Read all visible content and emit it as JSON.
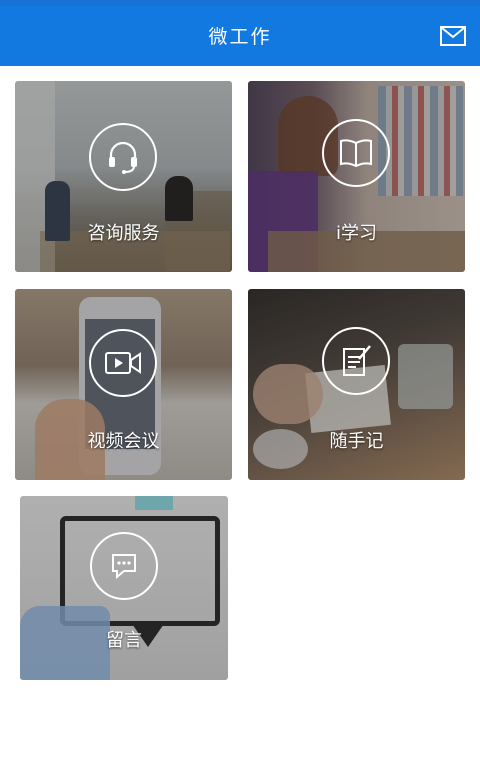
{
  "header": {
    "title": "微工作",
    "mail_icon": "mail-icon",
    "bg_color": "#1279e0"
  },
  "tiles": [
    {
      "label": "咨询服务",
      "icon": "headset-icon"
    },
    {
      "label": "i学习",
      "icon": "book-icon"
    },
    {
      "label": "视频会议",
      "icon": "video-camera-icon"
    },
    {
      "label": "随手记",
      "icon": "notepad-pen-icon"
    },
    {
      "label": "留言",
      "icon": "chat-bubble-icon"
    }
  ]
}
